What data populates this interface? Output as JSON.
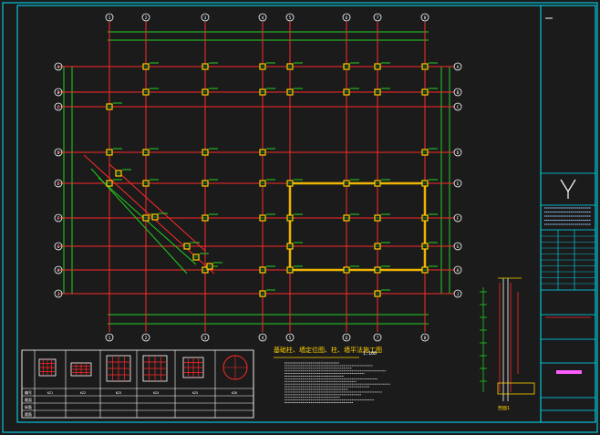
{
  "drawing": {
    "title": "基础柱、墙定位图、柱、墙平法施工图",
    "scale": "1:100",
    "grid_numbers_top": [
      "1",
      "2",
      "3",
      "4",
      "5",
      "6",
      "7",
      "8",
      "9"
    ],
    "grid_letters_left": [
      "A",
      "B",
      "C",
      "D",
      "E",
      "F",
      "G",
      "H",
      "J"
    ],
    "section_label": "剖面1",
    "colors": {
      "background": "#1b1b1b",
      "frame": "#00e5ff",
      "grid_axis": "#ff2a2a",
      "dimension": "#20d020",
      "column": "#ffd000",
      "wall": "#e8c800",
      "text": "#ffffff",
      "title_accent": "#ff5cff"
    }
  },
  "legend": {
    "types": [
      "KZ1",
      "KZ2",
      "KZ3",
      "KZ4",
      "KZ5",
      "KZ6"
    ],
    "row_headers": [
      "编号",
      "截面",
      "纵筋",
      "箍筋"
    ]
  }
}
